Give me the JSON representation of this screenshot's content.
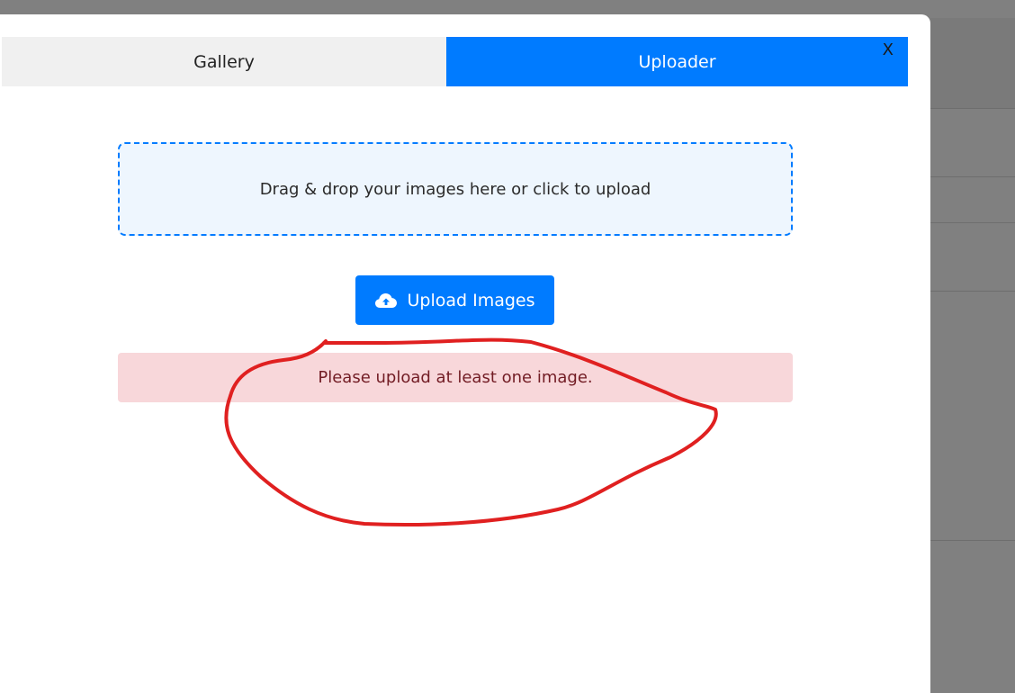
{
  "tabs": {
    "gallery_label": "Gallery",
    "uploader_label": "Uploader",
    "active": "Uploader"
  },
  "modal": {
    "close_label": "X"
  },
  "dropzone": {
    "text": "Drag & drop your images here or click to upload"
  },
  "upload_button": {
    "label": "Upload Images",
    "icon": "cloud-upload-icon"
  },
  "alert": {
    "message": "Please upload at least one image."
  },
  "colors": {
    "accent": "#007bff",
    "alert_bg": "#f8d7da",
    "alert_text": "#721c24",
    "annotation": "#e02020",
    "dropzone_bg": "#eef6fe",
    "overlay": "#808080"
  }
}
